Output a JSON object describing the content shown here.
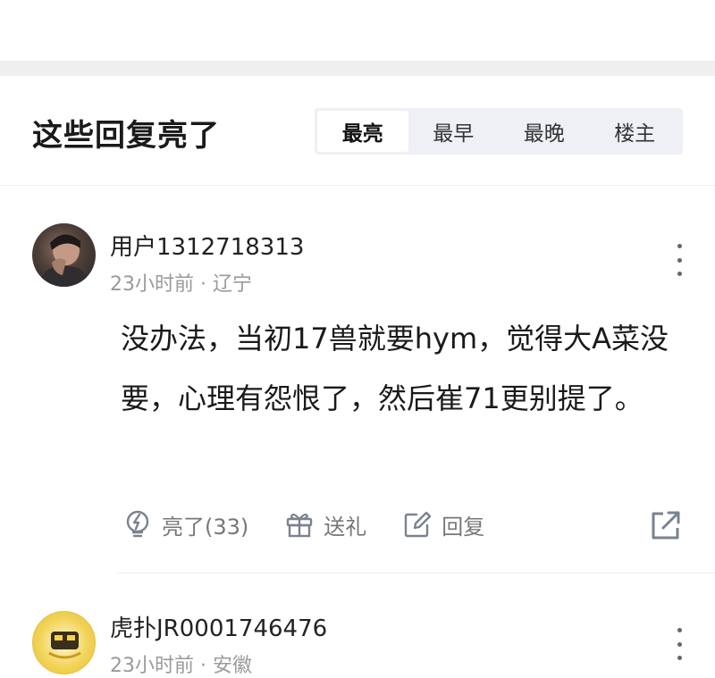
{
  "section": {
    "title": "这些回复亮了",
    "sort_tabs": [
      {
        "label": "最亮",
        "active": true
      },
      {
        "label": "最早",
        "active": false
      },
      {
        "label": "最晚",
        "active": false
      },
      {
        "label": "楼主",
        "active": false
      }
    ]
  },
  "comments": [
    {
      "username": "用户1312718313",
      "meta": "23小时前 · 辽宁",
      "avatar_icon": "user-photo-avatar",
      "body": "没办法，当初17兽就要hym，觉得大A菜没要，心理有怨恨了，然后崔71更别提了。",
      "actions": {
        "like_label": "亮了(33)",
        "gift_label": "送礼",
        "reply_label": "回复"
      }
    },
    {
      "username": "虎扑JR0001746476",
      "meta": "23小时前 · 安徽",
      "avatar_icon": "gold-badge-avatar"
    }
  ],
  "colors": {
    "tab_bg": "#eef0f5",
    "divider": "#efefef",
    "meta_text": "#9a9a9a",
    "icon": "#7a8290"
  }
}
